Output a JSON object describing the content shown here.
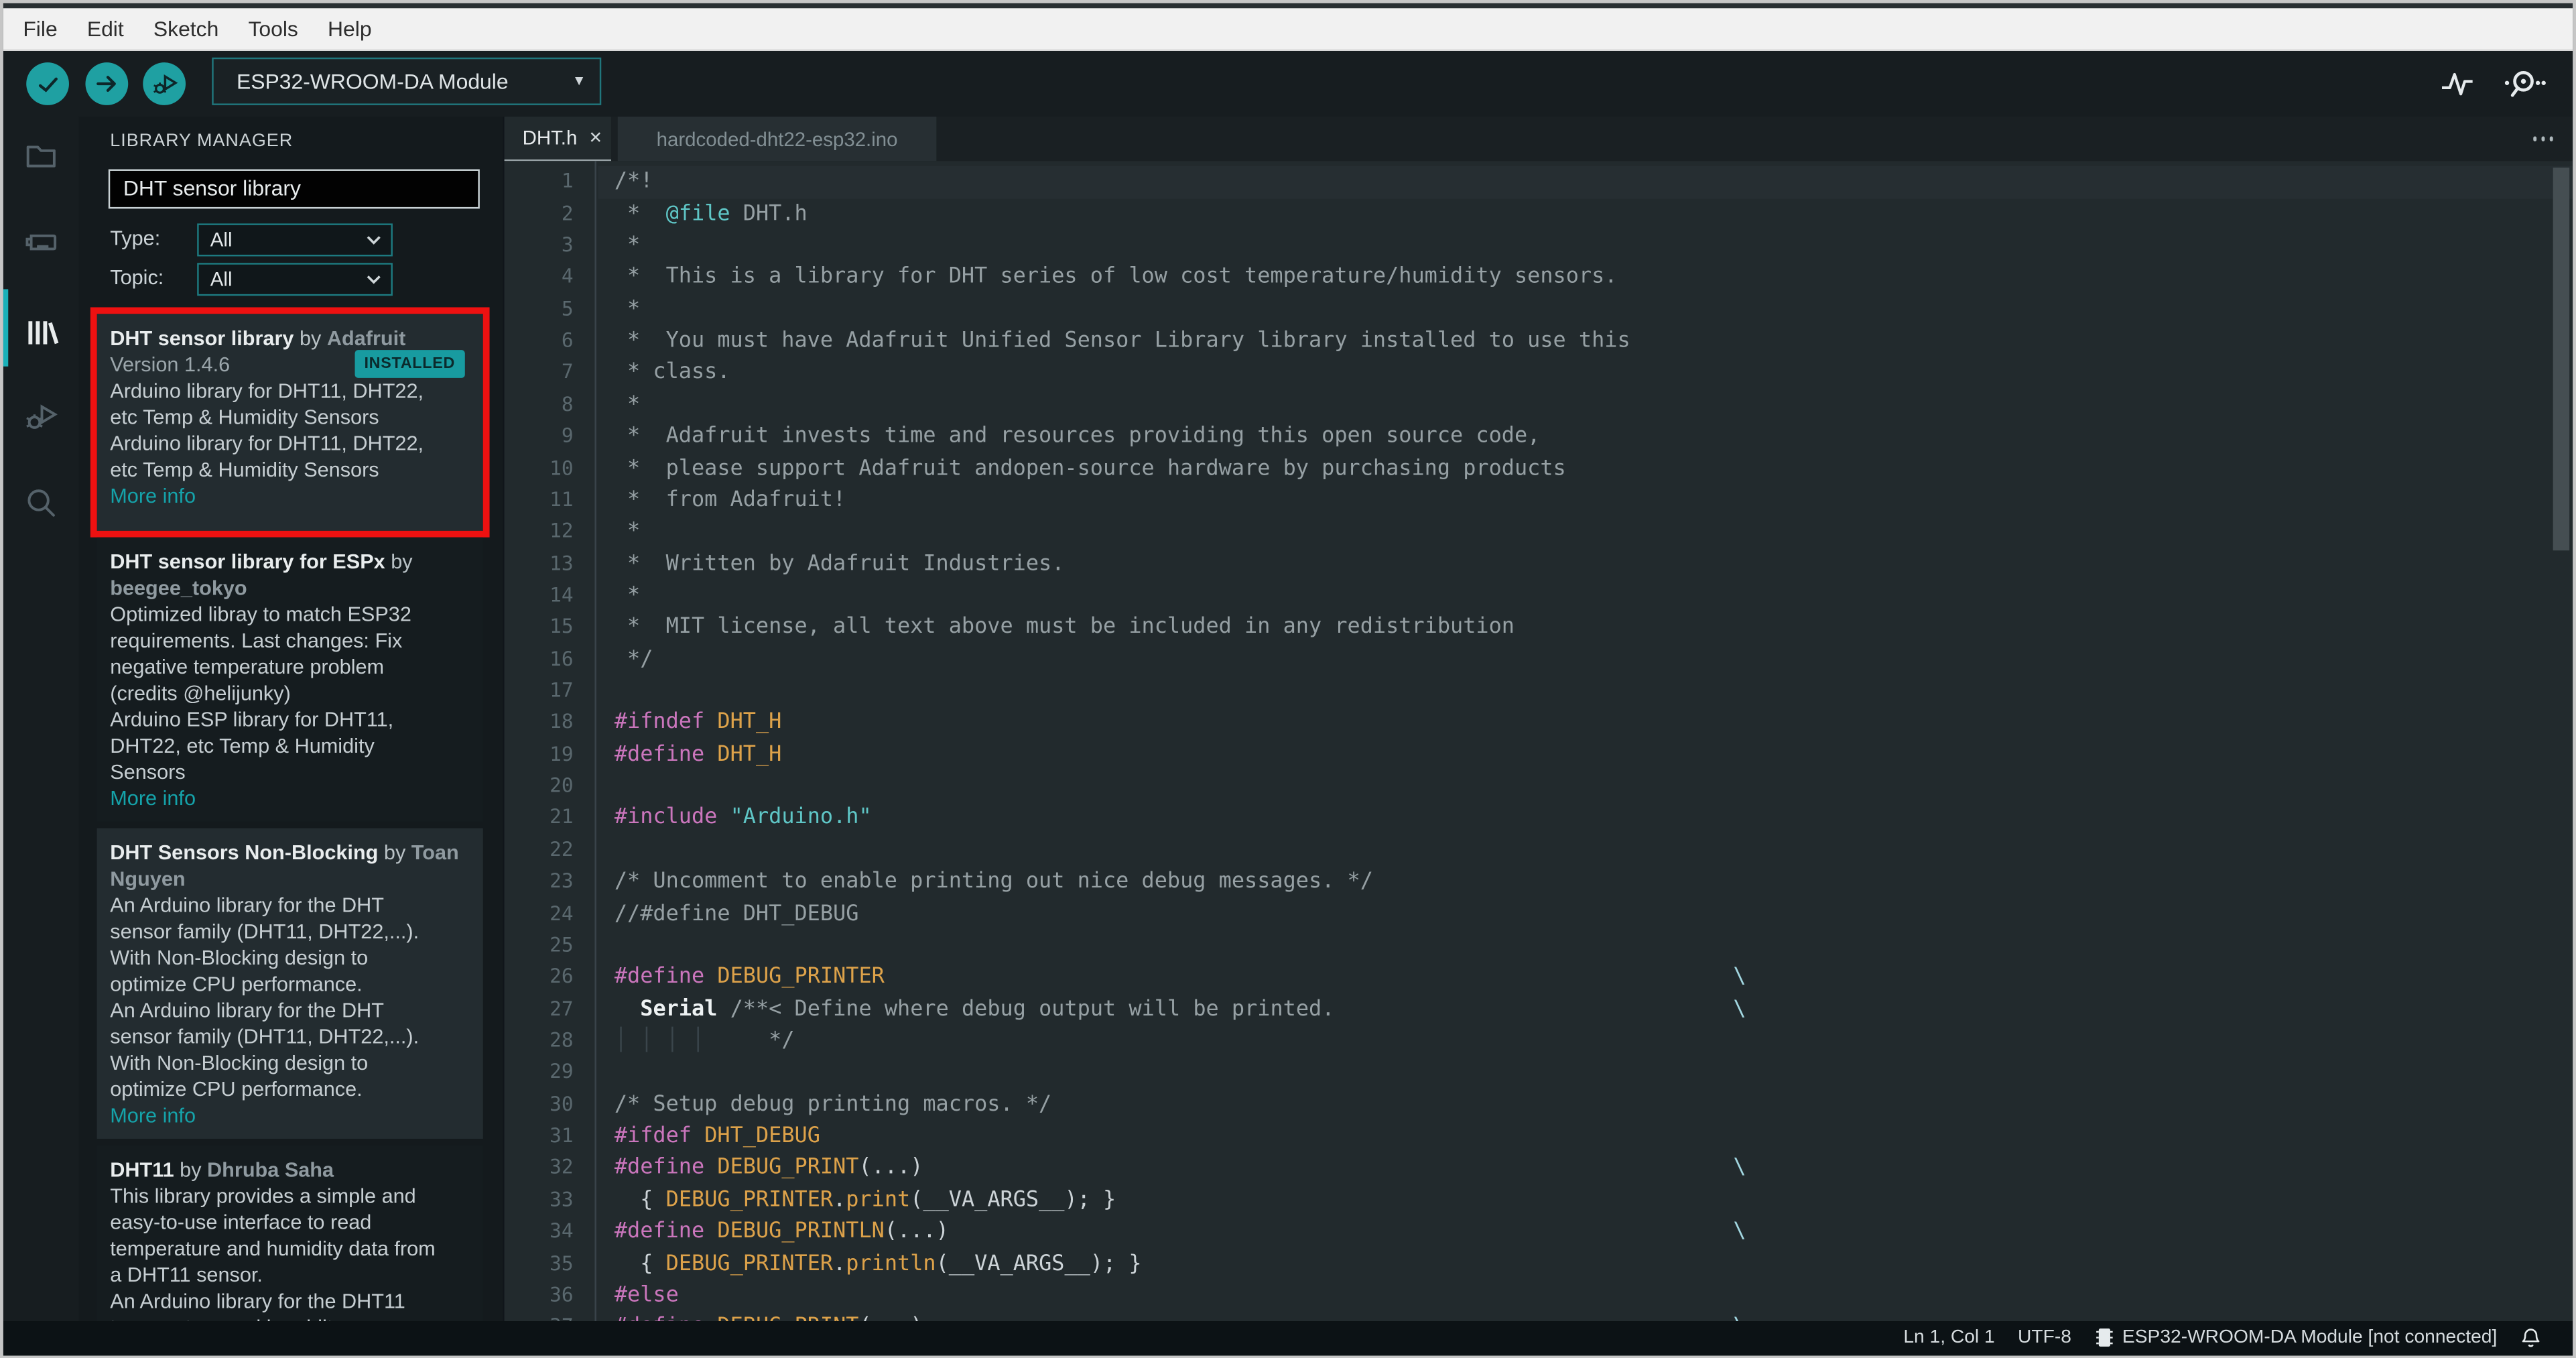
{
  "window": {
    "menu": [
      "File",
      "Edit",
      "Sketch",
      "Tools",
      "Help"
    ]
  },
  "toolbar": {
    "board_selector": "ESP32-WROOM-DA Module",
    "buttons": [
      "verify",
      "upload",
      "start-debugging"
    ],
    "right_icons": [
      "serial-plotter",
      "serial-monitor"
    ]
  },
  "activity_bar": {
    "items": [
      "sketchbook",
      "boards-manager",
      "library-manager",
      "debug",
      "search"
    ],
    "active": "library-manager"
  },
  "library_manager": {
    "title": "LIBRARY MANAGER",
    "search_value": "DHT sensor library",
    "filters": [
      {
        "label": "Type:",
        "value": "All"
      },
      {
        "label": "Topic:",
        "value": "All"
      }
    ],
    "entries": [
      {
        "name": "DHT sensor library",
        "by": " by ",
        "author": "Adafruit",
        "version": "Version 1.4.6",
        "badge": "INSTALLED",
        "highlighted": true,
        "desc": [
          "Arduino library for DHT11, DHT22,",
          "etc Temp & Humidity Sensors",
          "Arduino library for DHT11, DHT22,",
          "etc Temp & Humidity Sensors"
        ],
        "link": "More info"
      },
      {
        "name": "DHT sensor library for ESPx",
        "by": " by ",
        "author": "beegee_tokyo",
        "desc": [
          "Optimized libray to match ESP32",
          "requirements. Last changes: Fix",
          "negative temperature problem",
          "(credits @helijunky)",
          "Arduino ESP library for DHT11,",
          "DHT22, etc Temp & Humidity",
          "Sensors"
        ],
        "link": "More info"
      },
      {
        "name": "DHT Sensors Non-Blocking",
        "by": " by ",
        "author": "Toan Nguyen",
        "desc": [
          "An Arduino library for the DHT",
          "sensor family (DHT11, DHT22,...).",
          "With Non-Blocking design to",
          "optimize CPU performance.",
          "An Arduino library for the DHT",
          "sensor family (DHT11, DHT22,...).",
          "With Non-Blocking design to",
          "optimize CPU performance."
        ],
        "link": "More info"
      },
      {
        "name": "DHT11",
        "by": " by ",
        "author": "Dhruba Saha",
        "desc": [
          "This library provides a simple and",
          "easy-to-use interface to read",
          "temperature and humidity data from",
          "a DHT11 sensor.",
          "An Arduino library for the DHT11",
          "temperature and humidity sensor"
        ]
      }
    ]
  },
  "editor": {
    "tabs": [
      {
        "label": "DHT.h",
        "active": true
      },
      {
        "label": "hardcoded-dht22-esp32.ino",
        "active": false
      }
    ],
    "current_line": 1,
    "lines": [
      {
        "n": 1,
        "s": [
          [
            "cmt",
            "/*!"
          ]
        ]
      },
      {
        "n": 2,
        "s": [
          [
            "cmt",
            " *  "
          ],
          [
            "doc",
            "@file"
          ],
          [
            "cmt",
            " DHT.h"
          ]
        ]
      },
      {
        "n": 3,
        "s": [
          [
            "cmt",
            " *"
          ]
        ]
      },
      {
        "n": 4,
        "s": [
          [
            "cmt",
            " *  This is a library for DHT series of low cost temperature/humidity sensors."
          ]
        ]
      },
      {
        "n": 5,
        "s": [
          [
            "cmt",
            " *"
          ]
        ]
      },
      {
        "n": 6,
        "s": [
          [
            "cmt",
            " *  You must have Adafruit Unified Sensor Library library installed to use this"
          ]
        ]
      },
      {
        "n": 7,
        "s": [
          [
            "cmt",
            " * class."
          ]
        ]
      },
      {
        "n": 8,
        "s": [
          [
            "cmt",
            " *"
          ]
        ]
      },
      {
        "n": 9,
        "s": [
          [
            "cmt",
            " *  Adafruit invests time and resources providing this open source code,"
          ]
        ]
      },
      {
        "n": 10,
        "s": [
          [
            "cmt",
            " *  please support Adafruit andopen-source hardware by purchasing products"
          ]
        ]
      },
      {
        "n": 11,
        "s": [
          [
            "cmt",
            " *  from Adafruit!"
          ]
        ]
      },
      {
        "n": 12,
        "s": [
          [
            "cmt",
            " *"
          ]
        ]
      },
      {
        "n": 13,
        "s": [
          [
            "cmt",
            " *  Written by Adafruit Industries."
          ]
        ]
      },
      {
        "n": 14,
        "s": [
          [
            "cmt",
            " *"
          ]
        ]
      },
      {
        "n": 15,
        "s": [
          [
            "cmt",
            " *  MIT license, all text above must be included in any redistribution"
          ]
        ]
      },
      {
        "n": 16,
        "s": [
          [
            "cmt",
            " */"
          ]
        ]
      },
      {
        "n": 17,
        "s": []
      },
      {
        "n": 18,
        "s": [
          [
            "pp",
            "#ifndef"
          ],
          [
            "pun",
            " "
          ],
          [
            "mac",
            "DHT_H"
          ]
        ]
      },
      {
        "n": 19,
        "s": [
          [
            "pp",
            "#define"
          ],
          [
            "pun",
            " "
          ],
          [
            "mac",
            "DHT_H"
          ]
        ]
      },
      {
        "n": 20,
        "s": []
      },
      {
        "n": 21,
        "s": [
          [
            "pp",
            "#include"
          ],
          [
            "pun",
            " "
          ],
          [
            "str",
            "\"Arduino.h\""
          ]
        ]
      },
      {
        "n": 22,
        "s": []
      },
      {
        "n": 23,
        "s": [
          [
            "cmt",
            "/* Uncomment to enable printing out nice debug messages. */"
          ]
        ]
      },
      {
        "n": 24,
        "s": [
          [
            "cmt",
            "//#define DHT_DEBUG"
          ]
        ]
      },
      {
        "n": 25,
        "s": []
      },
      {
        "n": 26,
        "s": [
          [
            "pp",
            "#define"
          ],
          [
            "pun",
            " "
          ],
          [
            "mac",
            "DEBUG_PRINTER"
          ]
        ],
        "cont": true
      },
      {
        "n": 27,
        "s": [
          [
            "pun",
            "  "
          ],
          [
            "cls",
            "Serial"
          ],
          [
            "cmt",
            " /**< Define where debug output will be printed."
          ]
        ],
        "cont": true
      },
      {
        "n": 28,
        "s": [
          [
            "g",
            "│ │ │ │"
          ],
          [
            "cmt",
            "     */"
          ]
        ]
      },
      {
        "n": 29,
        "s": []
      },
      {
        "n": 30,
        "s": [
          [
            "cmt",
            "/* Setup debug printing macros. */"
          ]
        ]
      },
      {
        "n": 31,
        "s": [
          [
            "pp",
            "#ifdef"
          ],
          [
            "pun",
            " "
          ],
          [
            "mac",
            "DHT_DEBUG"
          ]
        ]
      },
      {
        "n": 32,
        "s": [
          [
            "pp",
            "#define"
          ],
          [
            "pun",
            " "
          ],
          [
            "mac",
            "DEBUG_PRINT"
          ],
          [
            "pun",
            "(...)"
          ]
        ],
        "cont": true
      },
      {
        "n": 33,
        "s": [
          [
            "pun",
            "  { "
          ],
          [
            "mac",
            "DEBUG_PRINTER"
          ],
          [
            "pun",
            "."
          ],
          [
            "mac",
            "print"
          ],
          [
            "pun",
            "(__VA_ARGS__); }"
          ]
        ]
      },
      {
        "n": 34,
        "s": [
          [
            "pp",
            "#define"
          ],
          [
            "pun",
            " "
          ],
          [
            "mac",
            "DEBUG_PRINTLN"
          ],
          [
            "pun",
            "(...)"
          ]
        ],
        "cont": true
      },
      {
        "n": 35,
        "s": [
          [
            "pun",
            "  { "
          ],
          [
            "mac",
            "DEBUG_PRINTER"
          ],
          [
            "pun",
            "."
          ],
          [
            "mac",
            "println"
          ],
          [
            "pun",
            "(__VA_ARGS__); }"
          ]
        ]
      },
      {
        "n": 36,
        "s": [
          [
            "pp",
            "#else"
          ]
        ]
      },
      {
        "n": 37,
        "s": [
          [
            "pp",
            "#define"
          ],
          [
            "pun",
            " "
          ],
          [
            "mac",
            "DEBUG_PRINT"
          ],
          [
            "pun",
            "(...)"
          ]
        ],
        "cont": true
      }
    ]
  },
  "status_bar": {
    "position": "Ln 1, Col 1",
    "encoding": "UTF-8",
    "board": "ESP32-WROOM-DA Module [not connected]"
  },
  "colors": {
    "accent": "#1fa0a2",
    "badge_bg": "#189ba0",
    "highlight_red": "#ee1111",
    "link": "#15a3aa",
    "indicator": "#19b0b8",
    "syntax": {
      "comment": "#96a0a4",
      "preprocessor": "#cb76bd",
      "macro": "#dda24a",
      "string": "#5fc6c6",
      "doc_tag": "#5fc6c6",
      "punctuation": "#ccd3d7",
      "class_name": "#eef2f3",
      "continuation": "#a3d8e2",
      "guide": "#3a454b"
    }
  }
}
